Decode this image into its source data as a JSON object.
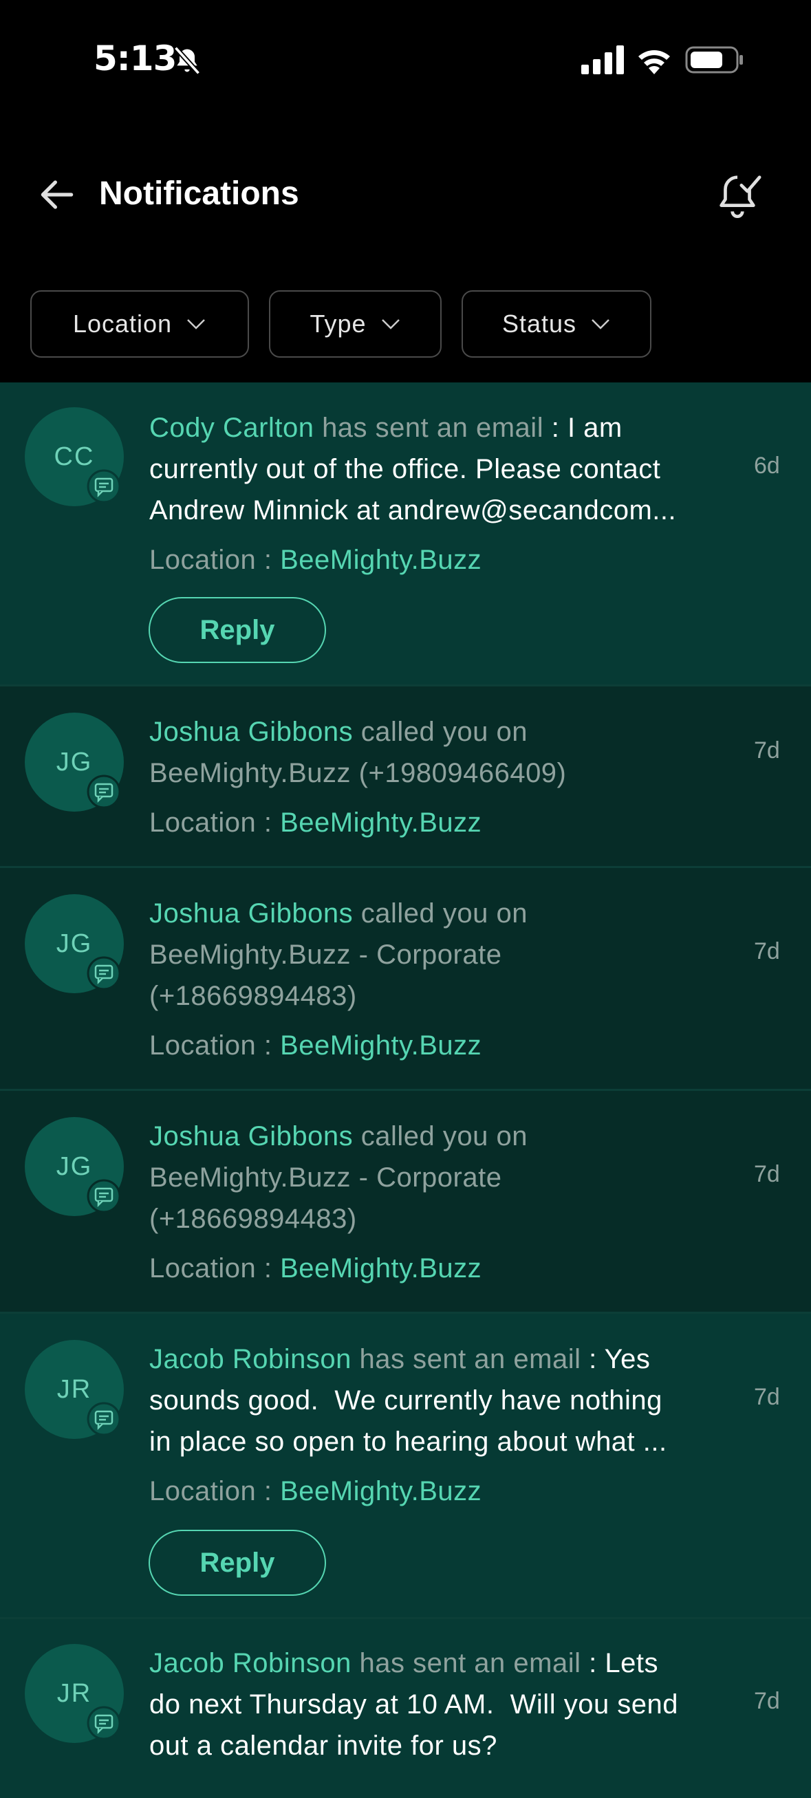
{
  "status_bar": {
    "time": "5:13"
  },
  "header": {
    "title": "Notifications"
  },
  "filters": [
    {
      "label": "Location"
    },
    {
      "label": "Type"
    },
    {
      "label": "Status"
    }
  ],
  "notifications": [
    {
      "initials": "CC",
      "name": "Cody Carlton",
      "action": "has sent an email",
      "separator": ":",
      "message_lines": [
        "I am",
        "currently out of the office. Please contact",
        "Andrew Minnick at andrew@secandcom..."
      ],
      "location_label": "Location :",
      "location": "BeeMighty.Buzz",
      "time": "6d",
      "reply_label": "Reply"
    },
    {
      "initials": "JG",
      "name": "Joshua Gibbons",
      "action_lines": [
        "called you on",
        "BeeMighty.Buzz (+19809466409)"
      ],
      "location_label": "Location :",
      "location": "BeeMighty.Buzz",
      "time": "7d"
    },
    {
      "initials": "JG",
      "name": "Joshua Gibbons",
      "action_lines": [
        "called you on",
        "BeeMighty.Buzz - Corporate",
        "(+18669894483)"
      ],
      "location_label": "Location :",
      "location": "BeeMighty.Buzz",
      "time": "7d"
    },
    {
      "initials": "JG",
      "name": "Joshua Gibbons",
      "action_lines": [
        "called you on",
        "BeeMighty.Buzz - Corporate",
        "(+18669894483)"
      ],
      "location_label": "Location :",
      "location": "BeeMighty.Buzz",
      "time": "7d"
    },
    {
      "initials": "JR",
      "name": "Jacob Robinson",
      "action": "has sent an email",
      "separator": ":",
      "message_lines": [
        "Yes",
        "sounds good.  We currently have nothing",
        "in place so open to hearing about what ..."
      ],
      "location_label": "Location :",
      "location": "BeeMighty.Buzz",
      "time": "7d",
      "reply_label": "Reply"
    },
    {
      "initials": "JR",
      "name": "Jacob Robinson",
      "action": "has sent an email",
      "separator": ":",
      "message_lines": [
        "Lets",
        "do next Thursday at 10 AM.  Will you send",
        "out a calendar invite for us?"
      ],
      "time": "7d"
    }
  ]
}
